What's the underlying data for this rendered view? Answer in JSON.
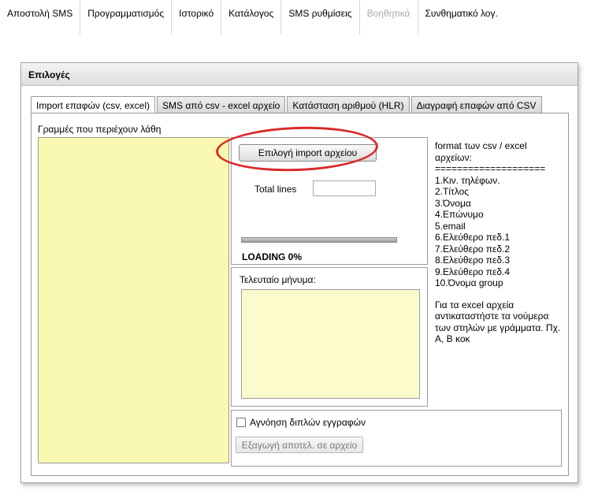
{
  "topnav": {
    "items": [
      {
        "label": "Αποστολή SMS",
        "disabled": false
      },
      {
        "label": "Προγραμματισμός",
        "disabled": false
      },
      {
        "label": "Ιστορικό",
        "disabled": false
      },
      {
        "label": "Κατάλογος",
        "disabled": false
      },
      {
        "label": "SMS ρυθμίσεις",
        "disabled": false
      },
      {
        "label": "Βοηθητικά",
        "disabled": true
      },
      {
        "label": "Συνθηματικό λογ.",
        "disabled": false
      }
    ]
  },
  "panel": {
    "title": "Επιλογές",
    "tabs": [
      {
        "label": "Import επαφών (csv, excel)",
        "active": true
      },
      {
        "label": "SMS από csv - excel αρχείο",
        "active": false
      },
      {
        "label": "Κατάσταση αριθμού (HLR)",
        "active": false
      },
      {
        "label": "Διαγραφή επαφών από CSV",
        "active": false
      }
    ]
  },
  "import_tab": {
    "errors_label": "Γραμμές που περιέχουν λάθη",
    "import_button": "Επιλογή import αρχείου",
    "total_lines_label": "Total lines",
    "total_lines_value": "",
    "progress_percent": 0,
    "loading_text": "LOADING 0%",
    "last_message_label": "Τελευταίο μήνυμα:",
    "last_message_value": "",
    "info_title": "format των csv / excel αρχείων:",
    "info_separator": "====================",
    "info_fields": [
      "1.Κιν. τηλέφων.",
      "2.Τίτλος",
      "3.Όνομα",
      "4.Επώνυμο",
      "5.email",
      "6.Ελεύθερο πεδ.1",
      "7.Ελεύθερο πεδ.2",
      "8.Ελεύθερο πεδ.3",
      "9.Ελεύθερο πεδ.4",
      "10.Όνομα group"
    ],
    "info_note": "Για τα excel αρχεία αντικαταστήστε τα νούμερα των στηλών με γράμματα. Πχ. A, B κοκ",
    "ignore_duplicates_label": "Αγνόηση διπλών εγγραφών",
    "ignore_duplicates_checked": false,
    "export_button": "Εξαγωγή αποτελ. σε αρχείο"
  },
  "colors": {
    "highlight": "#d92a2a",
    "error_area": "#f8f8b0",
    "message_area": "#fbfbcc",
    "disabled_text": "#a9a9a9"
  }
}
